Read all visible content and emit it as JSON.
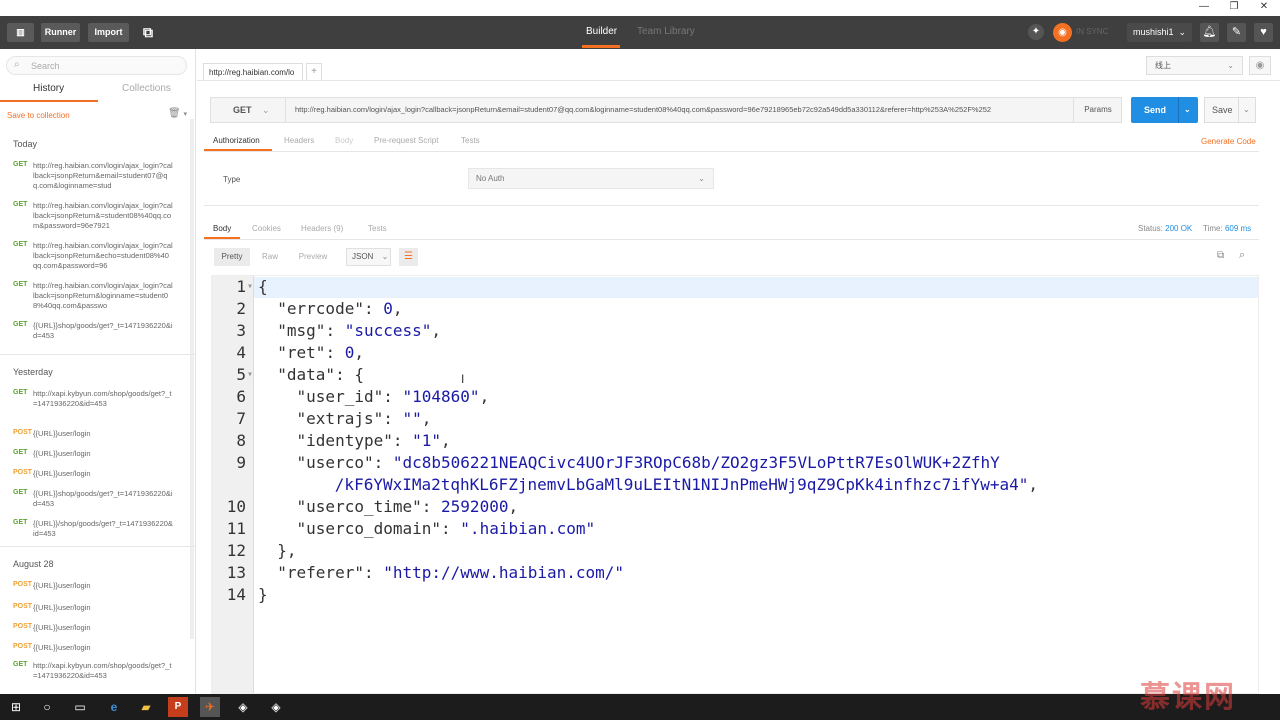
{
  "window": {
    "minimize": "—",
    "restore": "❐",
    "close": "✕"
  },
  "toolbar": {
    "runner": "Runner",
    "import": "Import",
    "builder_tab": "Builder",
    "team_library_tab": "Team Library",
    "sync_status": "IN SYNC",
    "user": "mushishi1"
  },
  "sidebar": {
    "search_placeholder": "Search",
    "tab_history": "History",
    "tab_collections": "Collections",
    "save_to_collection": "Save to collection",
    "groups": [
      {
        "label": "Today",
        "items": [
          {
            "method": "GET",
            "url": "http://reg.haibian.com/login/ajax_login?callback=jsonpReturn&email=student07@qq.com&loginname=stud"
          },
          {
            "method": "GET",
            "url": "http://reg.haibian.com/login/ajax_login?callback=jsonpReturn&=student08%40qq.com&password=96e7921"
          },
          {
            "method": "GET",
            "url": "http://reg.haibian.com/login/ajax_login?callback=jsonpReturn&echo=student08%40qq.com&password=96"
          },
          {
            "method": "GET",
            "url": "http://reg.haibian.com/login/ajax_login?callback=jsonpReturn&loginname=student08%40qq.com&passwo"
          },
          {
            "method": "GET",
            "url": "{{URL}}shop/goods/get?_t=1471936220&id=453"
          }
        ]
      },
      {
        "label": "Yesterday",
        "items": [
          {
            "method": "GET",
            "url": "http://xapi.kybyun.com/shop/goods/get?_t=1471936220&id=453"
          },
          {
            "method": "POST",
            "url": "{{URL}}user/login"
          },
          {
            "method": "GET",
            "url": "{{URL}}user/login"
          },
          {
            "method": "POST",
            "url": "{{URL}}user/login"
          },
          {
            "method": "GET",
            "url": "{{URL}}shop/goods/get?_t=1471936220&id=453"
          },
          {
            "method": "GET",
            "url": "{{URL}}/shop/goods/get?_t=1471936220&id=453"
          }
        ]
      },
      {
        "label": "August 28",
        "items": [
          {
            "method": "POST",
            "url": "{{URL}}user/login"
          },
          {
            "method": "POST",
            "url": "{{URL}}user/login"
          },
          {
            "method": "POST",
            "url": "{{URL}}user/login"
          },
          {
            "method": "POST",
            "url": "{{URL}}user/login"
          },
          {
            "method": "GET",
            "url": "http://xapi.kybyun.com/shop/goods/get?_t=1471936220&id=453"
          }
        ]
      }
    ]
  },
  "request": {
    "tab_label": "http://reg.haibian.com/lo",
    "environment": "线上",
    "method": "GET",
    "url": "http://reg.haibian.com/login/ajax_login?callback=jsonpReturn&email=student07@qq.com&loginname=student08%40qq.com&password=96e79218965eb72c92a549dd5a330112&referer=http%253A%252F%252",
    "params": "Params",
    "send": "Send",
    "save": "Save",
    "tabs": [
      "Authorization",
      "Headers",
      "Body",
      "Pre-request Script",
      "Tests"
    ],
    "generate_code": "Generate Code",
    "type_label": "Type",
    "auth_type": "No Auth"
  },
  "response": {
    "tabs": [
      "Body",
      "Cookies",
      "Headers (9)",
      "Tests"
    ],
    "status_label": "Status:",
    "status_value": "200 OK",
    "time_label": "Time:",
    "time_value": "609 ms",
    "view_modes": [
      "Pretty",
      "Raw",
      "Preview"
    ],
    "format": "JSON",
    "lines": [
      {
        "n": "1",
        "fold": "▾",
        "t": "{"
      },
      {
        "n": "2",
        "t": "  \"errcode\": 0,"
      },
      {
        "n": "3",
        "t": "  \"msg\": \"success\","
      },
      {
        "n": "4",
        "t": "  \"ret\": 0,"
      },
      {
        "n": "5",
        "fold": "▾",
        "t": "  \"data\": {"
      },
      {
        "n": "6",
        "t": "    \"user_id\": \"104860\","
      },
      {
        "n": "7",
        "t": "    \"extrajs\": \"\","
      },
      {
        "n": "8",
        "t": "    \"identype\": \"1\","
      },
      {
        "n": "9",
        "t": "    \"userco\": \"dc8b506221NEAQCivc4UOrJF3ROpC68b/ZO2gz3F5VLoPttR7EsOlWUK+2ZfhY"
      },
      {
        "n": "",
        "t": "        /kF6YWxIMa2tqhKL6FZjnemvLbGaMl9uLEItN1NIJnPmeHWj9qZ9CpKk4infhzc7ifYw+a4\","
      },
      {
        "n": "10",
        "t": "    \"userco_time\": 2592000,"
      },
      {
        "n": "11",
        "t": "    \"userco_domain\": \".haibian.com\""
      },
      {
        "n": "12",
        "t": "  },"
      },
      {
        "n": "13",
        "t": "  \"referer\": \"http://www.haibian.com/\""
      },
      {
        "n": "14",
        "t": "}"
      }
    ]
  },
  "watermark": "慕课网",
  "colors": {
    "accent": "#f47023",
    "send": "#1f8ee3",
    "toolbar": "#3f3f3f",
    "get": "#5ba32f",
    "post": "#f0a030"
  }
}
